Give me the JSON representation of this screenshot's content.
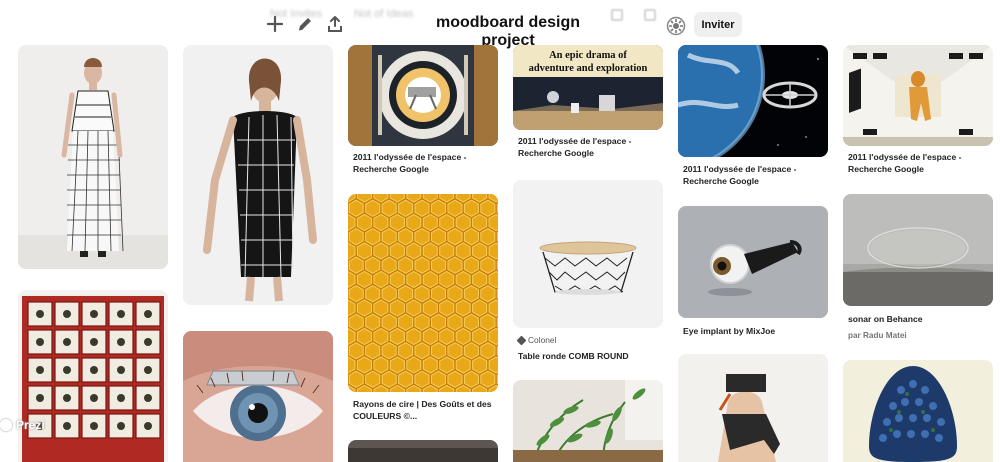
{
  "toolbar": {
    "ghost_left": "Not Invites",
    "ghost_right": "Not of Ideas",
    "title": "moodboard design project",
    "invite_label": "Inviter",
    "icons": [
      "plus-icon",
      "pencil-icon",
      "share-icon",
      "collaborators-icon"
    ]
  },
  "pins": {
    "fashion_left": {},
    "fashion_dress": {},
    "space_ring": {
      "caption": "2011 l'odyssée de l'espace - Recherche Google"
    },
    "space_poster": {
      "caption": "2011 l'odyssée de l'espace - Recherche Google",
      "poster_text": "An epic drama of adventure and exploration"
    },
    "space_earth": {
      "caption": "2011 l'odyssée de l'espace - Recherche Google"
    },
    "space_corridor": {
      "caption": "2011 l'odyssée de l'espace - Recherche Google"
    },
    "honeycomb": {
      "caption": "Rayons de cire | Des Goûts et des COULEURS ©..."
    },
    "table": {
      "source": "Colonel",
      "caption": "Table ronde COMB ROUND"
    },
    "eye_implant": {
      "caption": "Eye implant by MixJoe"
    },
    "sonar": {
      "caption": "sonar on Behance",
      "by": "par Radu Matei"
    },
    "eyes_box": {},
    "eye_closeup": {},
    "plant": {},
    "wrist": {},
    "egg": {},
    "small_bottom": {}
  },
  "watermark": "Prezi",
  "colors": {
    "background": "#ffffff",
    "invite_bg": "#efefef",
    "text": "#111111",
    "honey": "#e8a818"
  }
}
